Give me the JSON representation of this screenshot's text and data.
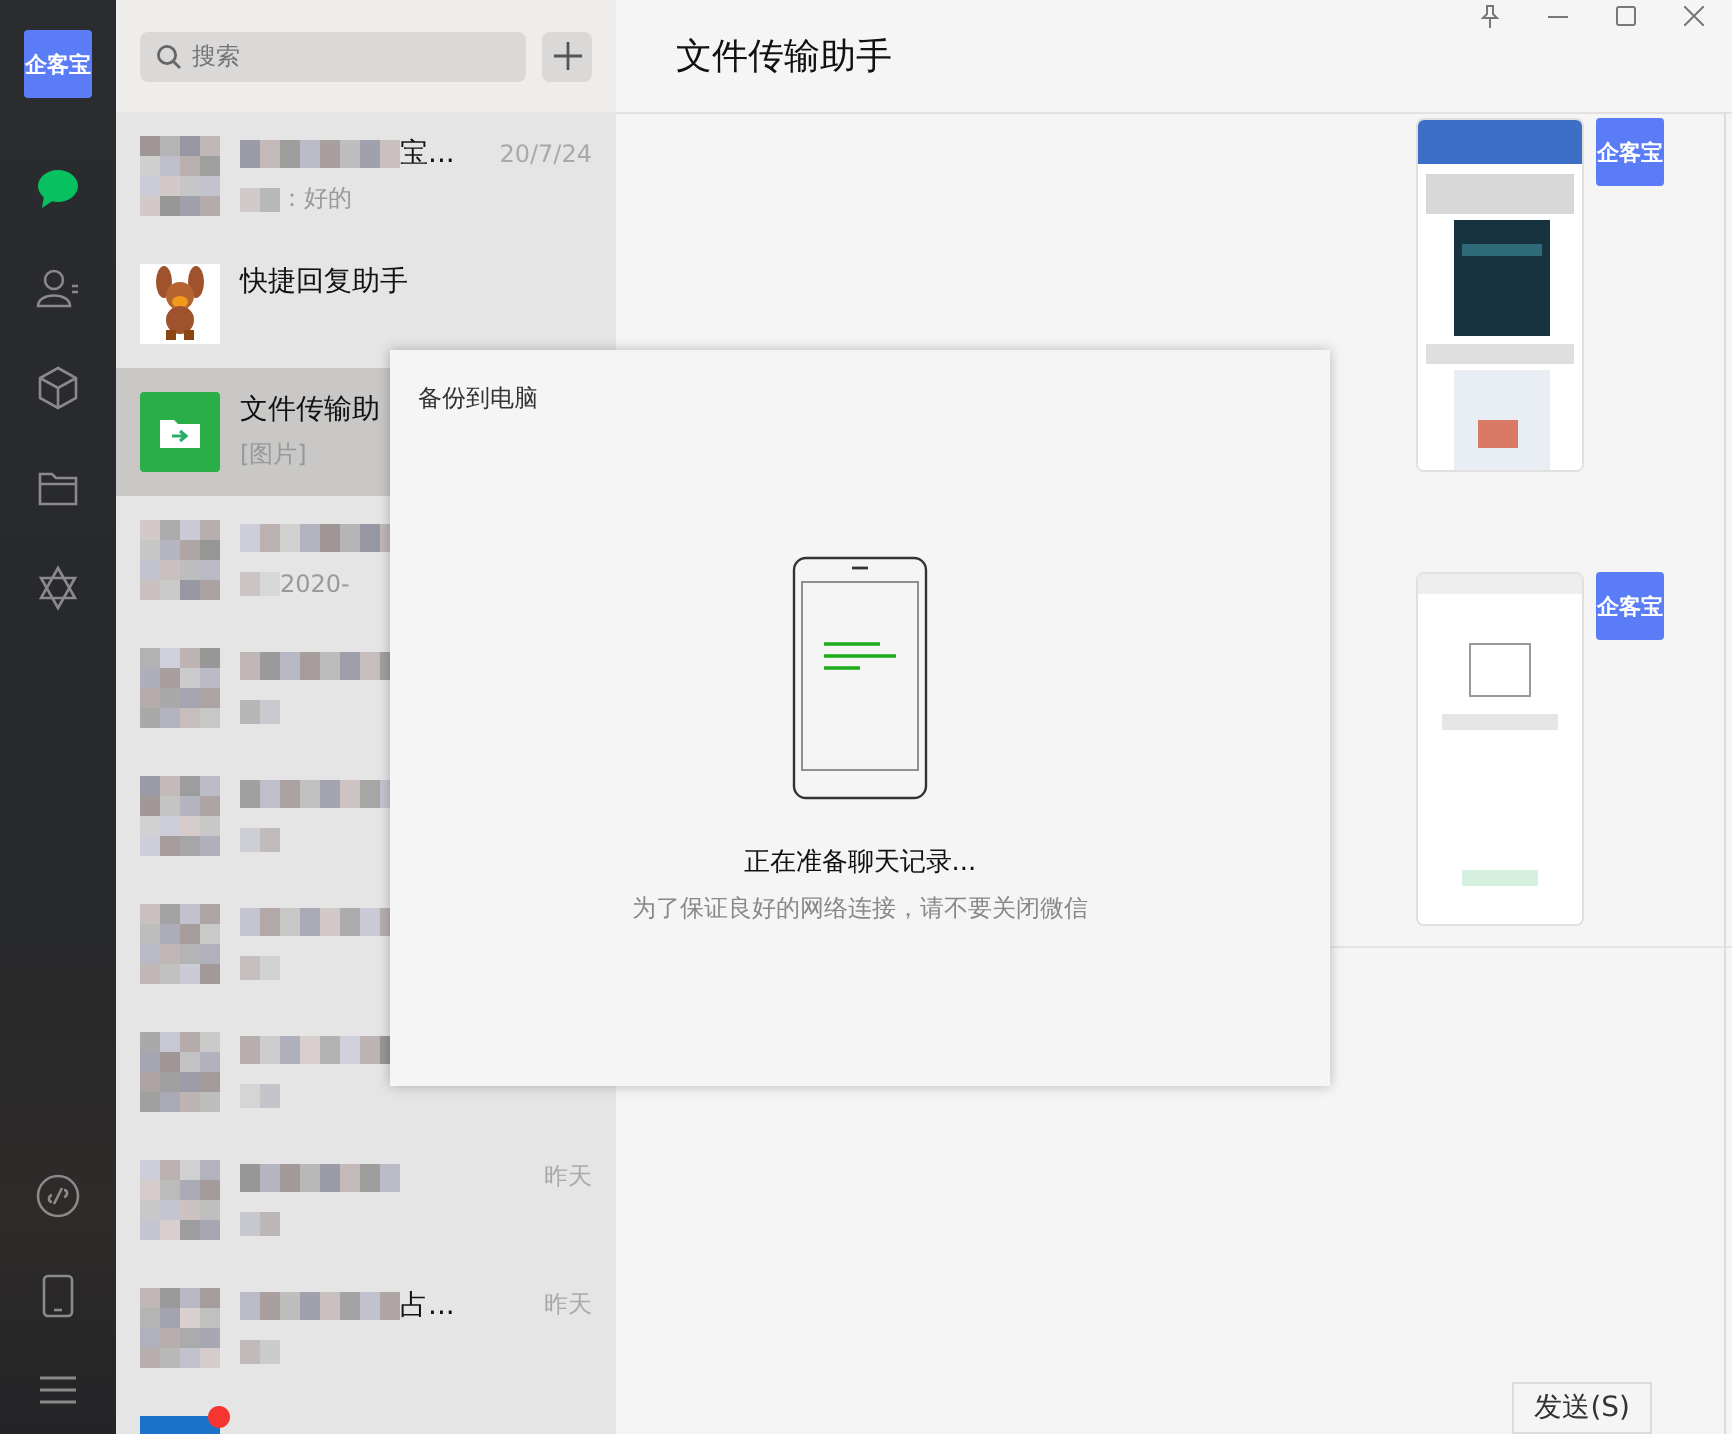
{
  "sidebar": {
    "logo": "企客宝",
    "items": [
      {
        "kind": "chat",
        "selected": true
      },
      {
        "kind": "contacts",
        "selected": false
      },
      {
        "kind": "box",
        "selected": false
      },
      {
        "kind": "folder",
        "selected": false
      },
      {
        "kind": "moments",
        "selected": false
      }
    ],
    "bottom": [
      {
        "kind": "miniapp"
      },
      {
        "kind": "phone"
      },
      {
        "kind": "menu"
      }
    ]
  },
  "search": {
    "placeholder": "搜索"
  },
  "chats": [
    {
      "kind": "mosaic",
      "name": "宝...",
      "preview": "：好的",
      "time": "20/7/24",
      "selected": false,
      "unread": false
    },
    {
      "kind": "rabbit",
      "name": "快捷回复助手",
      "selected": false,
      "unread": false
    },
    {
      "kind": "file",
      "name": "文件传输助",
      "preview": "[图片]",
      "selected": true,
      "unread": false
    },
    {
      "kind": "mosaic",
      "preview": "2020-",
      "selected": false,
      "unread": false
    },
    {
      "kind": "mosaic",
      "selected": false,
      "unread": false
    },
    {
      "kind": "mosaic",
      "selected": false,
      "unread": false
    },
    {
      "kind": "mosaic",
      "selected": false,
      "unread": false
    },
    {
      "kind": "mosaic",
      "selected": false,
      "unread": false
    },
    {
      "kind": "mosaic",
      "time": "昨天",
      "selected": false,
      "unread": false
    },
    {
      "kind": "mosaic",
      "name": "占...",
      "time": "昨天",
      "selected": false,
      "unread": false
    },
    {
      "kind": "blue",
      "selected": false,
      "unread": true
    }
  ],
  "chat": {
    "title": "文件传输助手",
    "messages": [
      {
        "kind": "picture",
        "sender": "企客宝"
      },
      {
        "kind": "picture",
        "sender": "企客宝"
      }
    ],
    "send_button": "发送(S)"
  },
  "dialog": {
    "title": "备份到电脑",
    "status": "正在准备聊天记录...",
    "hint": "为了保证良好的网络连接，请不要关闭微信"
  }
}
